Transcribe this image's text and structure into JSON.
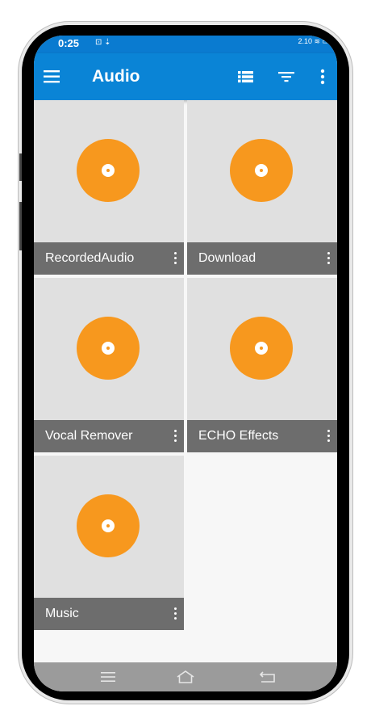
{
  "status_bar": {
    "time": "0:25",
    "left_icons": "⊡ ⇣",
    "right_icons": "2.10 ≋ ▭"
  },
  "app_bar": {
    "title": "Audio"
  },
  "folders": [
    {
      "name": "RecordedAudio"
    },
    {
      "name": "Download"
    },
    {
      "name": "Vocal Remover"
    },
    {
      "name": "ECHO Effects"
    },
    {
      "name": "Music"
    }
  ],
  "colors": {
    "app_bar": "#0a84d6",
    "disc": "#f7981e",
    "caption": "#6d6d6d",
    "tile": "#e0e0e0"
  },
  "icons": {
    "menu": "hamburger-icon",
    "view": "list-view-icon",
    "filter": "filter-icon",
    "more": "more-vert-icon",
    "nav_recents": "recents-icon",
    "nav_home": "home-icon",
    "nav_back": "back-icon"
  }
}
